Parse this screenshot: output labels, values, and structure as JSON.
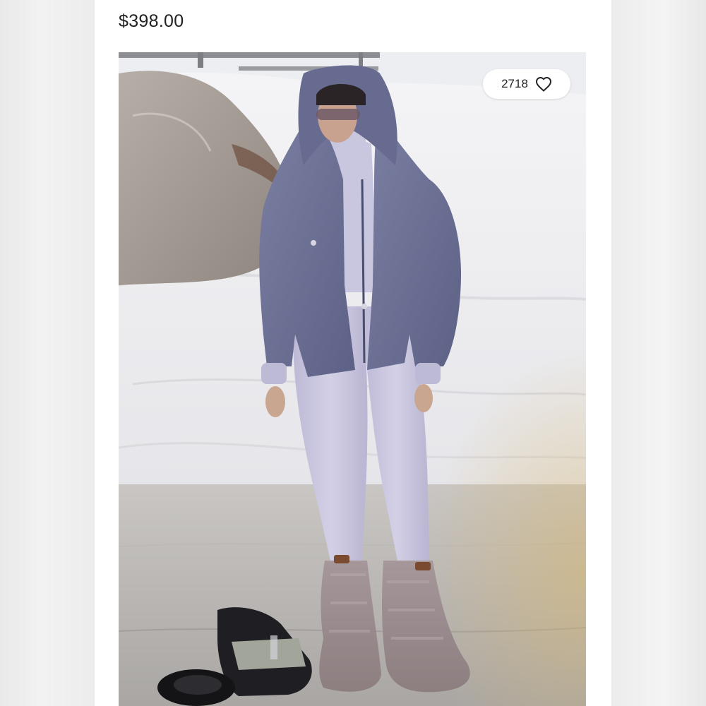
{
  "listing": {
    "price": "$398.00",
    "like_count": "2718",
    "like_icon": "heart-outline-icon"
  },
  "photo": {
    "subject": "product-photo",
    "colors": {
      "snow": "#f1f1f3",
      "sky": "#e7e8ec",
      "ground": "#b9b6b4",
      "jacket": "#6f7396",
      "bodysuit": "#c9c6df",
      "boots_fur": "#9f8f8d"
    }
  }
}
